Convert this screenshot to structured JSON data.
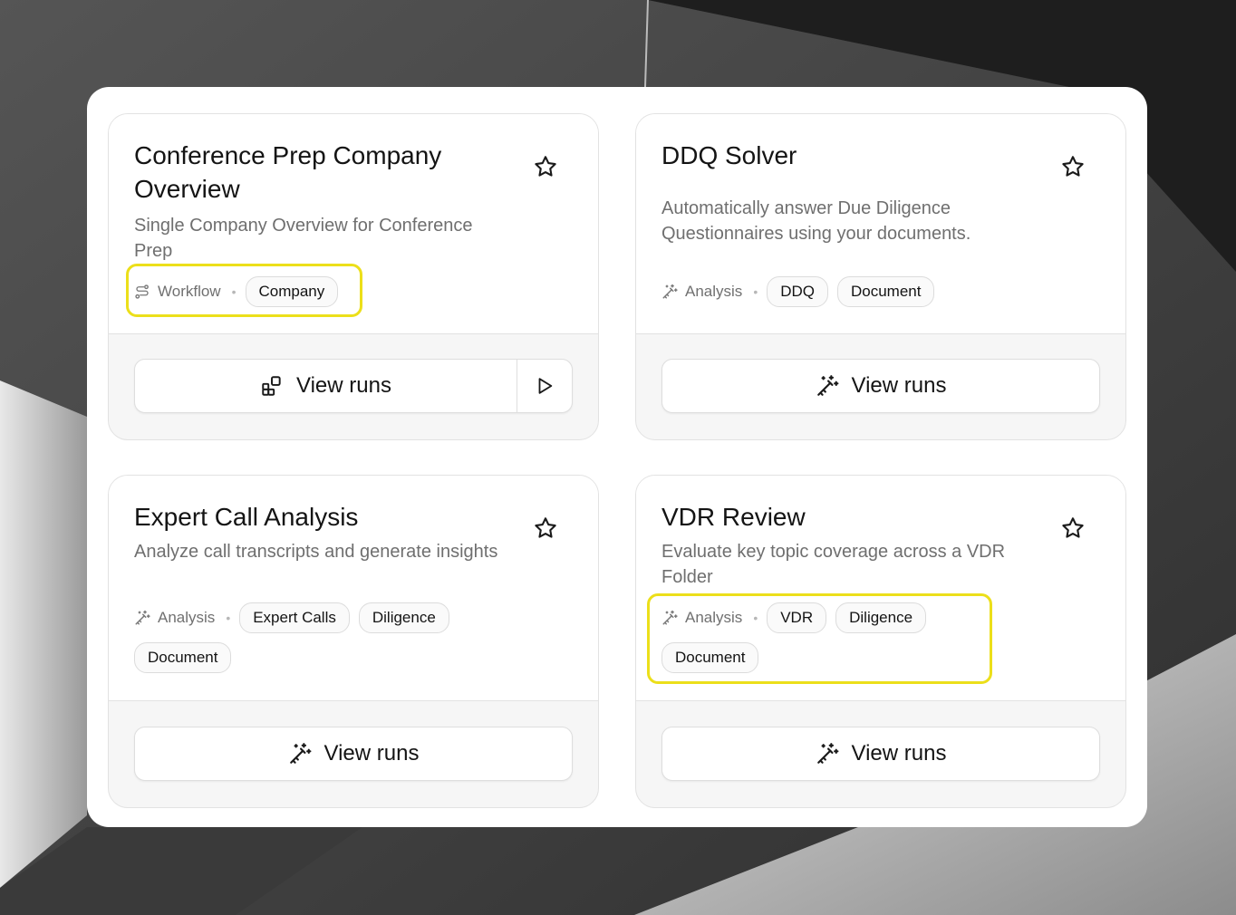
{
  "cards": [
    {
      "title": "Conference Prep Company Overview",
      "description": "Single Company Overview for Conference Prep",
      "kind": "Workflow",
      "kind_icon": "workflow-icon",
      "tags": [
        "Company"
      ],
      "button_label": "View runs",
      "button_icon": "blocks-icon",
      "has_run_button": true,
      "favorited": false
    },
    {
      "title": "DDQ Solver",
      "description": "Automatically answer Due Diligence Questionnaires using your documents.",
      "kind": "Analysis",
      "kind_icon": "magic-wand-icon",
      "tags": [
        "DDQ",
        "Document"
      ],
      "button_label": "View runs",
      "button_icon": "magic-wand-icon",
      "has_run_button": false,
      "favorited": false
    },
    {
      "title": "Expert Call Analysis",
      "description": "Analyze call transcripts and generate insights",
      "kind": "Analysis",
      "kind_icon": "magic-wand-icon",
      "tags": [
        "Expert Calls",
        "Diligence",
        "Document"
      ],
      "button_label": "View runs",
      "button_icon": "magic-wand-icon",
      "has_run_button": false,
      "favorited": false
    },
    {
      "title": "VDR Review",
      "description": "Evaluate key topic coverage across a VDR Folder",
      "kind": "Analysis",
      "kind_icon": "magic-wand-icon",
      "tags": [
        "VDR",
        "Diligence",
        "Document"
      ],
      "button_label": "View runs",
      "button_icon": "magic-wand-icon",
      "has_run_button": false,
      "favorited": false
    }
  ],
  "colors": {
    "highlight": "#ecdf1a",
    "card_background": "#f6f6f6",
    "text_primary": "#141414",
    "text_secondary": "#6f6f6f"
  }
}
